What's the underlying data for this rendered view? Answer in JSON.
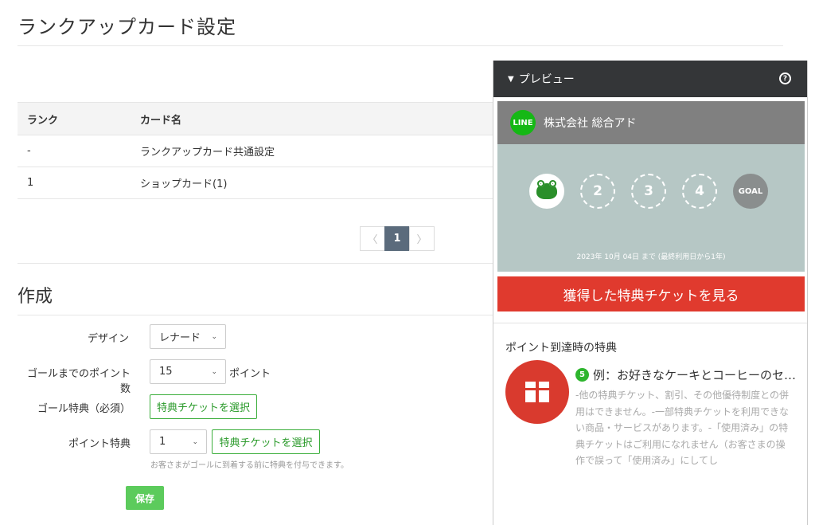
{
  "page": {
    "title": "ランクアップカード設定"
  },
  "table": {
    "headers": [
      "ランク",
      "カード名"
    ],
    "rows": [
      {
        "rank": "-",
        "name": "ランクアップカード共通設定"
      },
      {
        "rank": "1",
        "name": "ショップカード(1)"
      }
    ]
  },
  "pagination": {
    "prev": "〈",
    "current": "1",
    "next": "〉"
  },
  "create": {
    "title": "作成",
    "design_label": "デザイン",
    "design_value": "レナード",
    "goal_points_label": "ゴールまでのポイント数",
    "goal_points_value": "15",
    "points_unit": "ポイント",
    "goal_reward_label": "ゴール特典（必須）",
    "goal_reward_button": "特典チケットを選択",
    "point_reward_label": "ポイント特典",
    "point_reward_value": "1",
    "point_reward_button": "特典チケットを選択",
    "hint": "お客さまがゴールに到着する前に特典を付与できます。",
    "save": "保存"
  },
  "preview": {
    "header": "プレビュー",
    "collapse_glyph": "▼",
    "help_glyph": "?",
    "shop_name": "株式会社 総合アド",
    "logo_text": "LINE",
    "stamps": [
      "",
      "2",
      "3",
      "4",
      "GOAL"
    ],
    "expiry": "2023年 10月 04日 まで (最終利用日から1年)",
    "ticket_button": "獲得した特典チケットを見る",
    "section_title": "ポイント到達時の特典",
    "perk_number": "5",
    "perk_title": "例：お好きなケーキとコーヒーのセ…",
    "perk_desc": "-他の特典チケット、割引、その他優待制度との併用はできません。-一部特典チケットを利用できない商品・サービスがあります。-「使用済み」の特典チケットはご利用になれません（お客さまの操作で誤って「使用済み」にしてし",
    "colors": {
      "header": "#343638",
      "card": "#b6c7c5",
      "red": "#e03a2e",
      "green": "#2db52d"
    }
  }
}
